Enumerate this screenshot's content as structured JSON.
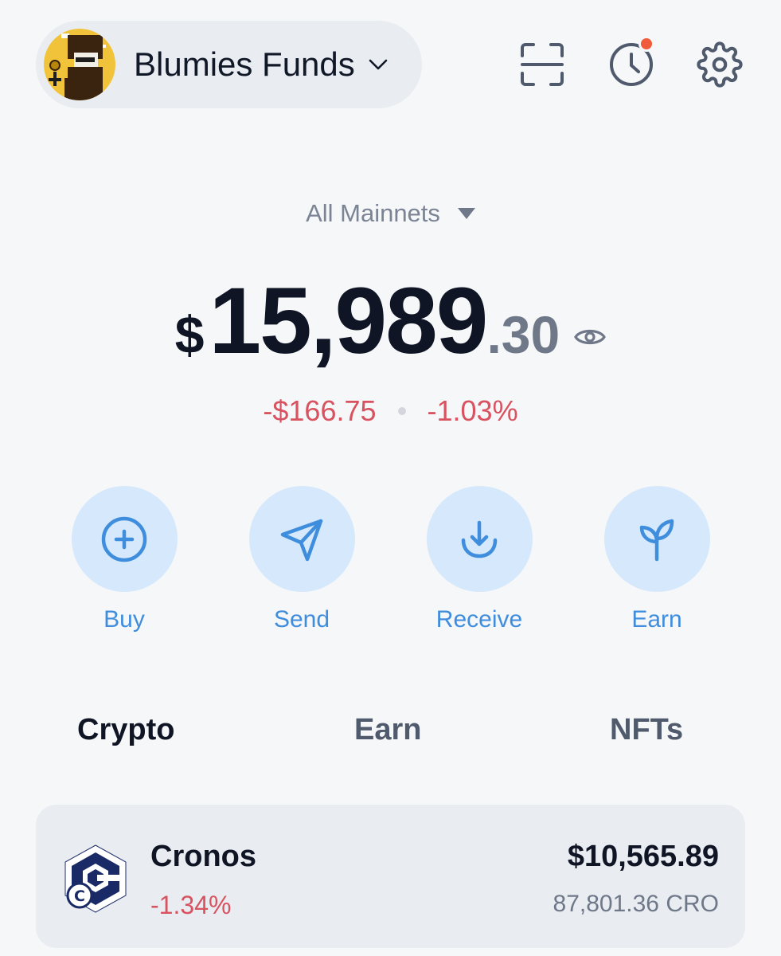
{
  "header": {
    "account_name": "Blumies Funds",
    "avatar_icon": "pixel-art-avatar",
    "scan_icon": "scan-icon",
    "history_icon": "history-clock-icon",
    "settings_icon": "gear-icon",
    "notification_dot_color": "#ef5b3b"
  },
  "network": {
    "label": "All Mainnets"
  },
  "balance": {
    "currency": "$",
    "integer": "15,989",
    "decimal": ".30",
    "change_amount": "-$166.75",
    "change_percent": "-1.03%"
  },
  "actions": [
    {
      "label": "Buy",
      "icon": "plus-circle-icon"
    },
    {
      "label": "Send",
      "icon": "send-arrow-icon"
    },
    {
      "label": "Receive",
      "icon": "download-arrow-icon"
    },
    {
      "label": "Earn",
      "icon": "sprout-icon"
    }
  ],
  "tabs": [
    {
      "label": "Crypto",
      "active": true
    },
    {
      "label": "Earn",
      "active": false
    },
    {
      "label": "NFTs",
      "active": false
    }
  ],
  "tokens": [
    {
      "name": "Cronos",
      "change": "-1.34%",
      "value": "$10,565.89",
      "amount": "87,801.36 CRO",
      "icon": "cronos-logo-icon"
    }
  ],
  "colors": {
    "accent": "#3f8ede",
    "action_bg": "#d6e8fb",
    "negative": "#d8525f",
    "background": "#f6f7f9"
  }
}
